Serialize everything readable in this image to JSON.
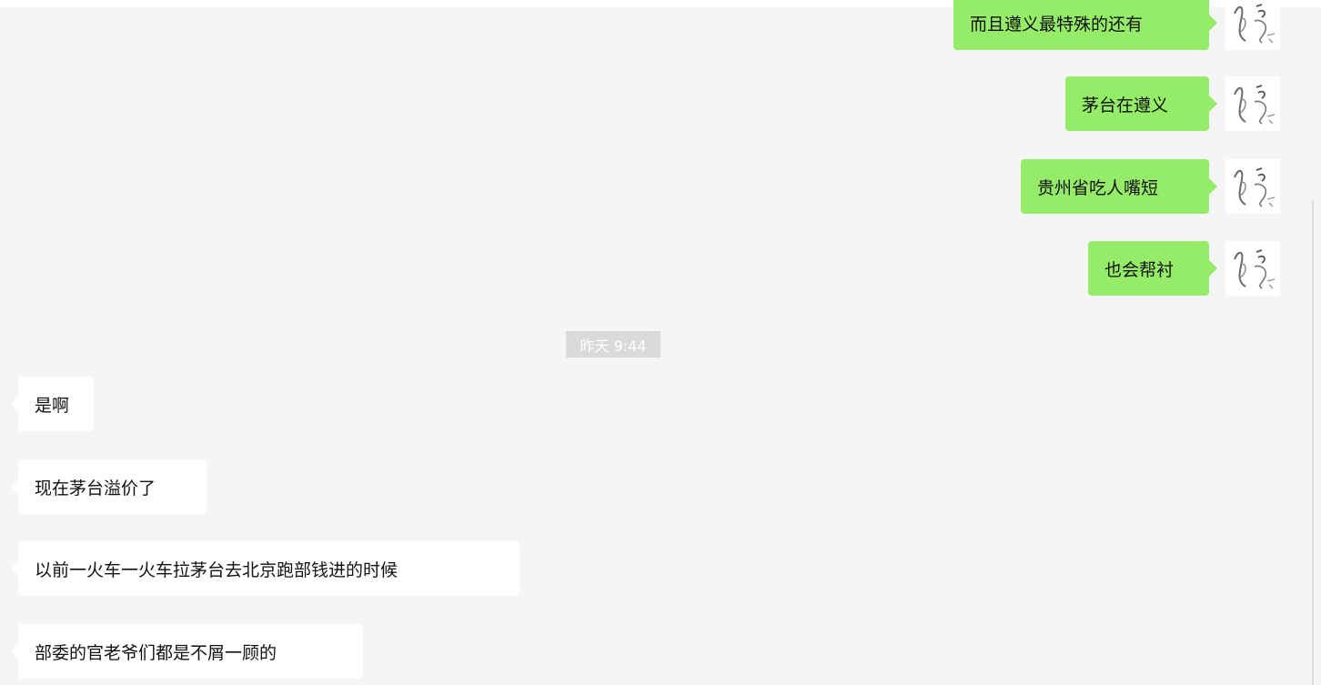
{
  "messages_outgoing": [
    {
      "text": "而且遵义最特殊的还有"
    },
    {
      "text": "茅台在遵义"
    },
    {
      "text": "贵州省吃人嘴短"
    },
    {
      "text": "也会帮衬"
    }
  ],
  "timestamp": "昨天 9:44",
  "messages_incoming": [
    {
      "text": "是啊"
    },
    {
      "text": "现在茅台溢价了"
    },
    {
      "text": "以前一火车一火车拉茅台去北京跑部钱进的时候"
    },
    {
      "text": "部委的官老爷们都是不屑一顾的"
    }
  ],
  "colors": {
    "background": "#f5f5f5",
    "outgoing_bubble": "#95ec69",
    "incoming_bubble": "#ffffff",
    "timestamp_bg": "#dadada"
  },
  "avatar_icon": "ink-sketch-avatar-icon"
}
